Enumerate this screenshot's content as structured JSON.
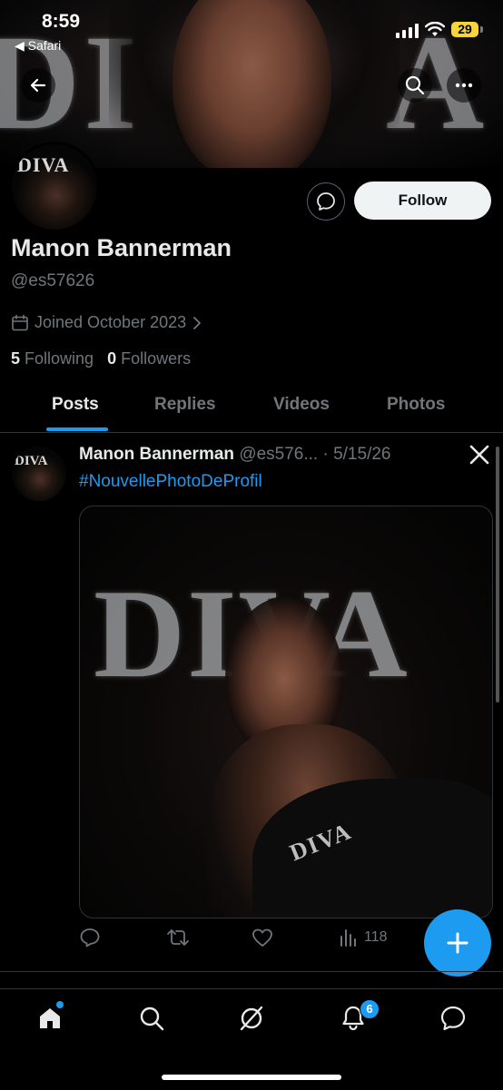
{
  "status_bar": {
    "time": "8:59",
    "back_app": "◀ Safari",
    "battery": "29"
  },
  "banner": {
    "letters_left": "DI",
    "letters_right": "A"
  },
  "profile": {
    "avatar_text": "DIVA",
    "follow_label": "Follow",
    "name": "Manon Bannerman",
    "handle": "@es57626",
    "joined": "Joined October 2023",
    "following_count": "5",
    "following_label": "Following",
    "followers_count": "0",
    "followers_label": "Followers"
  },
  "tabs": [
    {
      "label": "Posts",
      "active": true
    },
    {
      "label": "Replies",
      "active": false
    },
    {
      "label": "Videos",
      "active": false
    },
    {
      "label": "Photos",
      "active": false
    }
  ],
  "post": {
    "author": "Manon Bannerman",
    "meta": "@es576... · 5/15/26",
    "hashtag": "#NouvellePhotoDeProfil",
    "media_letters": "DIVA",
    "coat_text": "DIVA",
    "views": "118"
  },
  "bottom_nav": {
    "notification_count": "6"
  },
  "colors": {
    "accent": "#1d9bf0",
    "muted": "#71767b",
    "text": "#e7e9ea",
    "divider": "#2f3336"
  }
}
